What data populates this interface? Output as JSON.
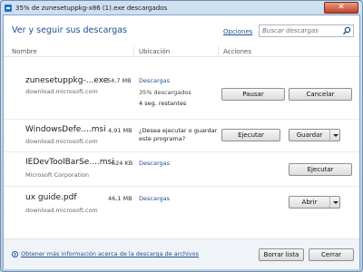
{
  "window": {
    "title": "35% de zunesetuppkg-x86 (1).exe descargados",
    "close_label": "✕"
  },
  "header": {
    "heading": "Ver y seguir sus descargas",
    "options_link": "Opciones",
    "search_placeholder": "Buscar descargas"
  },
  "columns": {
    "name": "Nombre",
    "location": "Ubicación",
    "actions": "Acciones"
  },
  "downloads": [
    {
      "name": "zunesetuppkg-...exe",
      "size": "54,7 MB",
      "source": "download.microsoft.com",
      "location": "Descargas",
      "progress_text": "35% descargados",
      "remaining": "4 seg. restantes",
      "progress": 0.35,
      "buttons": [
        "Pausar",
        "Cancelar"
      ]
    },
    {
      "name": "WindowsDefe....msi",
      "size": "4,91 MB",
      "source": "download.microsoft.com",
      "prompt": "¿Desea ejecutar o guardar este programa?",
      "buttons": [
        "Ejecutar",
        "Guardar"
      ]
    },
    {
      "name": "IEDevToolBarSe....msi",
      "size": "624 KB",
      "source": "Microsoft Corporation",
      "location": "Descargas",
      "buttons": [
        "Ejecutar"
      ]
    },
    {
      "name": "ux guide.pdf",
      "size": "46,1 MB",
      "source": "download.microsoft.com",
      "location": "Descargas",
      "buttons": [
        "Abrir"
      ]
    }
  ],
  "footer": {
    "info_link": "Obtener más información acerca de la descarga de archivos",
    "clear_list": "Borrar lista",
    "close": "Cerrar"
  },
  "icons": {
    "title": "download-manager-icon",
    "search": "search-icon",
    "info": "info-icon",
    "dropdown": "chevron-down-icon"
  },
  "colors": {
    "link": "#1e4f91",
    "close_button": "#c1412a"
  }
}
